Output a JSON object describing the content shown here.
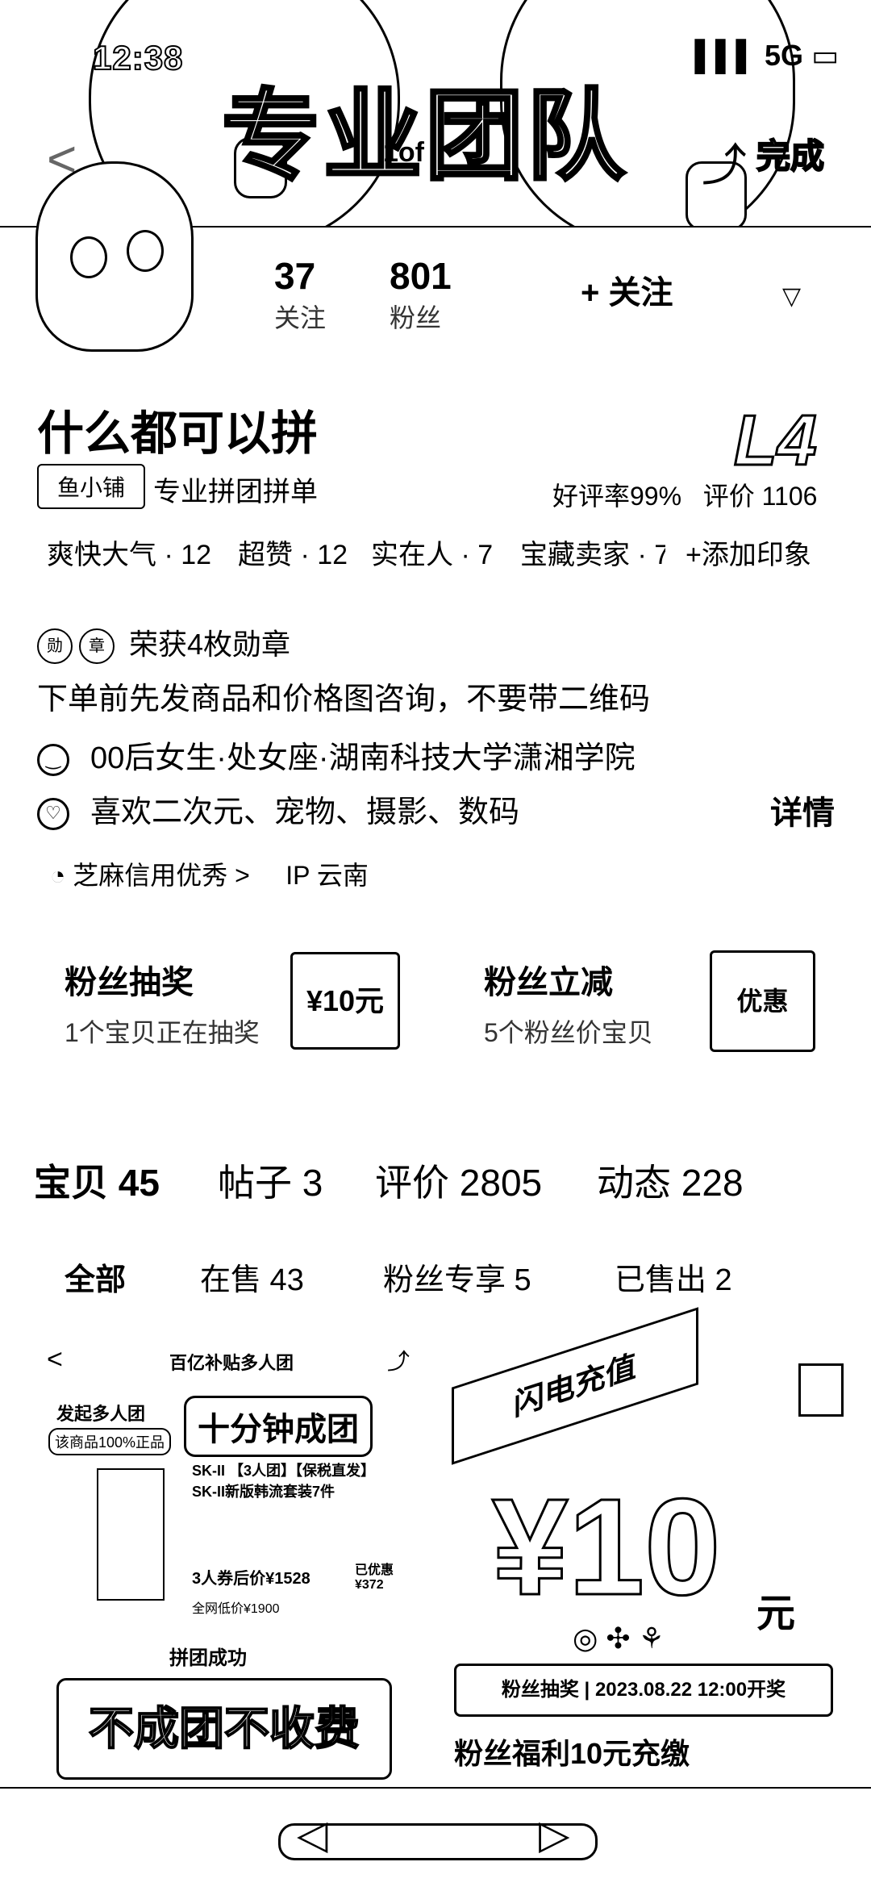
{
  "status": {
    "time": "12:38",
    "signal": "5G"
  },
  "banner": {
    "title": "专业团队",
    "mid_text": "1of",
    "back_label": "<",
    "done_label": "完成"
  },
  "profile": {
    "following_count": "37",
    "following_label": "关注",
    "followers_count": "801",
    "followers_label": "粉丝",
    "follow_button": "+ 关注",
    "name": "什么都可以拼",
    "level": "L4",
    "shop_badge": "鱼小铺",
    "tagline": "专业拼团拼单",
    "good_rate": "好评率99%",
    "review_count": "评价 1106"
  },
  "impressions": [
    "爽快大气 · 12",
    "超赞 · 12",
    "实在人 · 7",
    "宝藏卖家 · 7"
  ],
  "add_impression": "+添加印象",
  "medals_text": "荣获4枚勋章",
  "description": "下单前先发商品和价格图咨询，不要带二维码",
  "info_line1": "00后女生·处女座·湖南科技大学潇湘学院",
  "info_line2": "喜欢二次元、宠物、摄影、数码",
  "detail_label": "详情",
  "credit": "芝麻信用优秀 >",
  "ip": "IP 云南",
  "cards": {
    "lottery_title": "粉丝抽奖",
    "lottery_sub": "1个宝贝正在抽奖",
    "lottery_thumb": "¥10元",
    "discount_title": "粉丝立减",
    "discount_sub": "5个粉丝价宝贝",
    "discount_thumb": "优惠"
  },
  "tabs": [
    "宝贝 45",
    "帖子 3",
    "评价 2805",
    "动态 228"
  ],
  "subtabs": [
    "全部",
    "在售 43",
    "粉丝专享 5",
    "已售出 2"
  ],
  "product_left": {
    "header": "百亿补贴多人团",
    "host": "发起多人团",
    "authentic": "该商品100%正品",
    "headline": "十分钟成团",
    "item": "SK-II 【3人团】【保税直发】SK-II新版韩流套装7件",
    "price_label": "3人券后价¥1528",
    "saved": "已优惠 ¥372",
    "orig": "全网低价¥1900",
    "success": "拼团成功",
    "bottom": "不成团不收费"
  },
  "product_right": {
    "flash": "闪电充值",
    "price": "¥10",
    "unit": "元",
    "draw": "粉丝抽奖 | 2023.08.22 12:00开奖",
    "caption": "粉丝福利10元充缴"
  }
}
